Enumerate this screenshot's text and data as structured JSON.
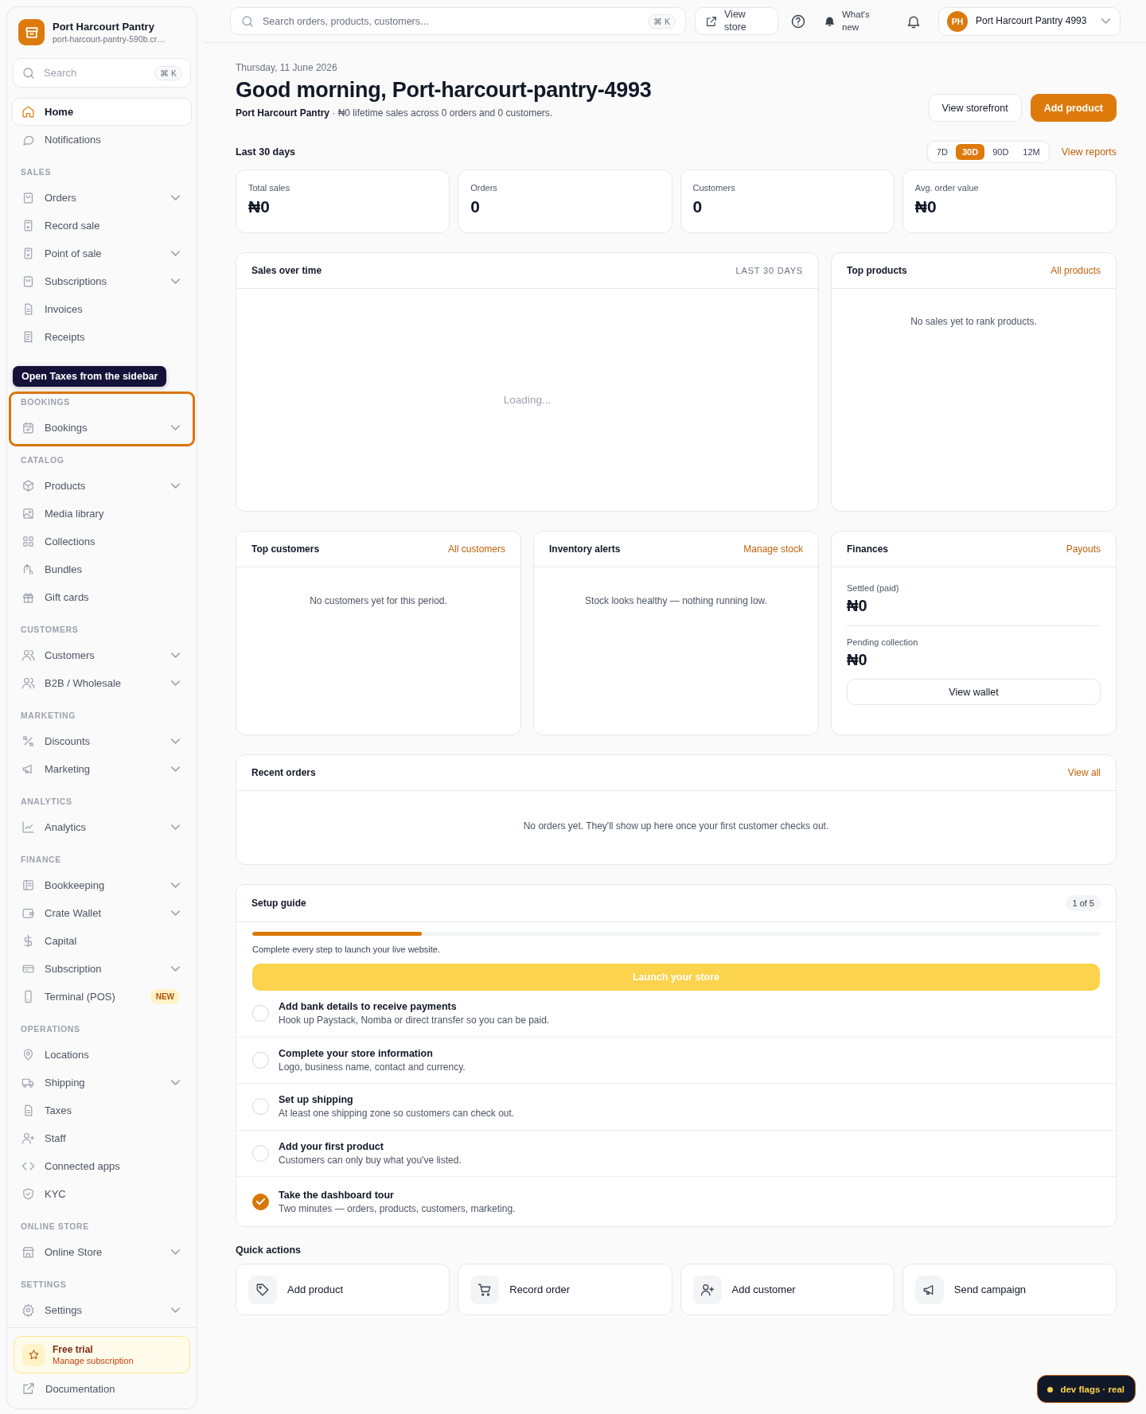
{
  "sidebar": {
    "store_name": "Port Harcourt Pantry",
    "store_url": "port-harcourt-pantry-590b.cr…",
    "search": {
      "placeholder": "Search",
      "shortcut": "⌘ K"
    },
    "sections": [
      {
        "spotlight": false,
        "items": [
          {
            "label": "Home",
            "selected": true,
            "expandable": false
          },
          {
            "label": "Notifications",
            "selected": false,
            "expandable": false
          }
        ]
      },
      {
        "heading": "SALES",
        "spotlight": false,
        "items": [
          {
            "label": "Orders",
            "selected": false,
            "expandable": true
          },
          {
            "label": "Record sale",
            "selected": false,
            "expandable": false
          },
          {
            "label": "Point of sale",
            "selected": false,
            "expandable": true
          },
          {
            "label": "Subscriptions",
            "selected": false,
            "expandable": true
          },
          {
            "label": "Invoices",
            "selected": false,
            "expandable": false
          },
          {
            "label": "Receipts",
            "selected": false,
            "expandable": false
          }
        ]
      },
      {
        "heading": "BOOKINGS",
        "spotlight": true,
        "tooltip": "Open Taxes from the sidebar",
        "items": [
          {
            "label": "Bookings",
            "selected": false,
            "expandable": true
          }
        ]
      },
      {
        "heading": "CATALOG",
        "spotlight": false,
        "items": [
          {
            "label": "Products",
            "selected": false,
            "expandable": true
          },
          {
            "label": "Media library",
            "selected": false,
            "expandable": false
          },
          {
            "label": "Collections",
            "selected": false,
            "expandable": false
          },
          {
            "label": "Bundles",
            "selected": false,
            "expandable": false
          },
          {
            "label": "Gift cards",
            "selected": false,
            "expandable": false
          }
        ]
      },
      {
        "heading": "CUSTOMERS",
        "spotlight": false,
        "items": [
          {
            "label": "Customers",
            "selected": false,
            "expandable": true
          },
          {
            "label": "B2B / Wholesale",
            "selected": false,
            "expandable": true
          }
        ]
      },
      {
        "heading": "MARKETING",
        "spotlight": false,
        "items": [
          {
            "label": "Discounts",
            "selected": false,
            "expandable": true
          },
          {
            "label": "Marketing",
            "selected": false,
            "expandable": true
          }
        ]
      },
      {
        "heading": "ANALYTICS",
        "spotlight": false,
        "items": [
          {
            "label": "Analytics",
            "selected": false,
            "expandable": true
          }
        ]
      },
      {
        "heading": "FINANCE",
        "spotlight": false,
        "items": [
          {
            "label": "Bookkeeping",
            "selected": false,
            "expandable": true
          },
          {
            "label": "Crate Wallet",
            "selected": false,
            "expandable": true
          },
          {
            "label": "Capital",
            "selected": false,
            "expandable": false
          },
          {
            "label": "Subscription",
            "selected": false,
            "expandable": true
          },
          {
            "label": "Terminal (POS)",
            "selected": false,
            "expandable": false,
            "badge": "NEW"
          }
        ]
      },
      {
        "heading": "OPERATIONS",
        "spotlight": false,
        "items": [
          {
            "label": "Locations",
            "selected": false,
            "expandable": false
          },
          {
            "label": "Shipping",
            "selected": false,
            "expandable": true
          },
          {
            "label": "Taxes",
            "selected": false,
            "expandable": false
          },
          {
            "label": "Staff",
            "selected": false,
            "expandable": false
          },
          {
            "label": "Connected apps",
            "selected": false,
            "expandable": false
          },
          {
            "label": "KYC",
            "selected": false,
            "expandable": false
          }
        ]
      },
      {
        "heading": "ONLINE STORE",
        "spotlight": false,
        "items": [
          {
            "label": "Online Store",
            "selected": false,
            "expandable": true
          }
        ]
      },
      {
        "heading": "SETTINGS",
        "spotlight": false,
        "items": [
          {
            "label": "Settings",
            "selected": false,
            "expandable": true
          }
        ]
      }
    ],
    "trial": {
      "title": "Free trial",
      "link": "Manage subscription"
    },
    "documentation": "Documentation"
  },
  "topbar": {
    "search": {
      "placeholder": "Search orders, products, customers...",
      "shortcut": "⌘ K"
    },
    "view_store": "View store",
    "whats_new": "What's new",
    "account": {
      "initials": "PH",
      "name": "Port Harcourt Pantry 4993"
    }
  },
  "header": {
    "date": "Thursday, 11 June 2026",
    "greeting": "Good morning, Port-harcourt-pantry-4993",
    "summary": "**Port Harcourt Pantry** · ₦0 lifetime sales across 0 orders and 0 customers.",
    "actions": [
      {
        "label": "View storefront",
        "kind": "secondary"
      },
      {
        "label": "Add product",
        "kind": "primary"
      }
    ]
  },
  "period": {
    "label": "Last 30 days",
    "options": [
      {
        "label": "7D",
        "selected": false
      },
      {
        "label": "30D",
        "selected": true
      },
      {
        "label": "90D",
        "selected": false
      },
      {
        "label": "12M",
        "selected": false
      }
    ],
    "link": "View reports"
  },
  "stats": [
    {
      "label": "Total sales",
      "value": "₦0"
    },
    {
      "label": "Orders",
      "value": "0"
    },
    {
      "label": "Customers",
      "value": "0"
    },
    {
      "label": "Avg. order value",
      "value": "₦0"
    }
  ],
  "sales_over_time": {
    "title": "Sales over time",
    "range": "LAST 30 DAYS",
    "status": "Loading..."
  },
  "top_products": {
    "title": "Top products",
    "link": "All products",
    "empty": "No sales yet to rank products."
  },
  "top_customers": {
    "title": "Top customers",
    "link": "All customers",
    "empty": "No customers yet for this period."
  },
  "inventory_alerts": {
    "title": "Inventory alerts",
    "link": "Manage stock",
    "empty": "Stock looks healthy — nothing running low."
  },
  "finances": {
    "title": "Finances",
    "link": "Payouts",
    "rows": [
      {
        "label": "Settled (paid)",
        "value": "₦0"
      },
      {
        "label": "Pending collection",
        "value": "₦0"
      }
    ],
    "button": "View wallet"
  },
  "recent_orders": {
    "title": "Recent orders",
    "link": "View all",
    "empty": "No orders yet. They'll show up here once your first customer checks out."
  },
  "setup_guide": {
    "title": "Setup guide",
    "count": "1 of 5",
    "level": 0.2,
    "note": "Complete every step to launch your live website.",
    "button": {
      "label": "Launch your store",
      "disabled": true
    },
    "steps": [
      {
        "title": "Add bank details to receive payments",
        "description": "Hook up Paystack, Nomba or direct transfer so you can be paid.",
        "done": false
      },
      {
        "title": "Complete your store information",
        "description": "Logo, business name, contact and currency.",
        "done": false
      },
      {
        "title": "Set up shipping",
        "description": "At least one shipping zone so customers can check out.",
        "done": false
      },
      {
        "title": "Add your first product",
        "description": "Customers can only buy what you've listed.",
        "done": false
      },
      {
        "title": "Take the dashboard tour",
        "description": "Two minutes — orders, products, customers, marketing.",
        "done": true
      }
    ]
  },
  "quick_actions": {
    "title": "Quick actions",
    "items": [
      {
        "label": "Add product"
      },
      {
        "label": "Record order"
      },
      {
        "label": "Add customer"
      },
      {
        "label": "Send campaign"
      }
    ]
  },
  "dev_badge": "dev flags · real"
}
